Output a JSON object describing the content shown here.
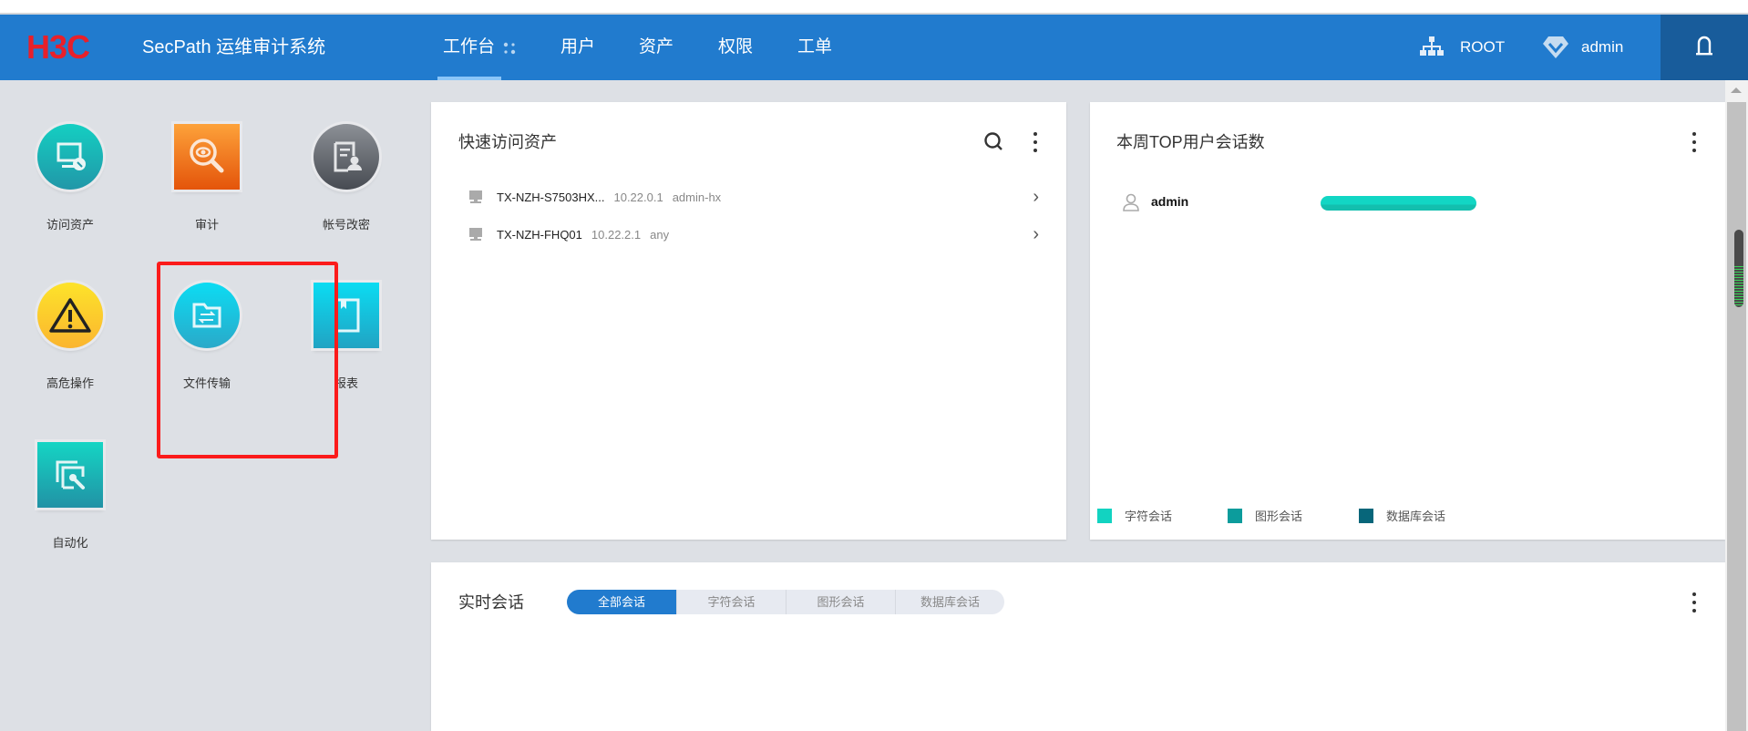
{
  "header": {
    "logo": "H3C",
    "title": "SecPath 运维审计系统",
    "nav": [
      "工作台",
      "用户",
      "资产",
      "权限",
      "工单"
    ],
    "active_nav": "工作台",
    "org": "ROOT",
    "user": "admin"
  },
  "tiles": [
    {
      "label": "访问资产",
      "color": "#1fb3ad"
    },
    {
      "label": "审计",
      "color": "#f07a1a"
    },
    {
      "label": "帐号改密",
      "color": "#5f6368"
    },
    {
      "label": "高危操作",
      "color": "#fdd124"
    },
    {
      "label": "文件传输",
      "color": "#1cc4e0"
    },
    {
      "label": "报表",
      "color": "#15c0df"
    },
    {
      "label": "自动化",
      "color": "#1ab3a9"
    }
  ],
  "quick_assets": {
    "title": "快速访问资产",
    "rows": [
      {
        "name": "TX-NZH-S7503HX...",
        "ip": "10.22.0.1",
        "account": "admin-hx"
      },
      {
        "name": "TX-NZH-FHQ01",
        "ip": "10.22.2.1",
        "account": "any"
      }
    ]
  },
  "top_users": {
    "title": "本周TOP用户会话数",
    "users": [
      {
        "name": "admin",
        "fraction": 1.0
      }
    ],
    "legend": [
      {
        "label": "字符会话",
        "color": "#12d3c1"
      },
      {
        "label": "图形会话",
        "color": "#0c9c9c"
      },
      {
        "label": "数据库会话",
        "color": "#07667a"
      }
    ]
  },
  "realtime": {
    "title": "实时会话",
    "tabs": [
      "全部会话",
      "字符会话",
      "图形会话",
      "数据库会话"
    ],
    "active_tab": 0
  }
}
